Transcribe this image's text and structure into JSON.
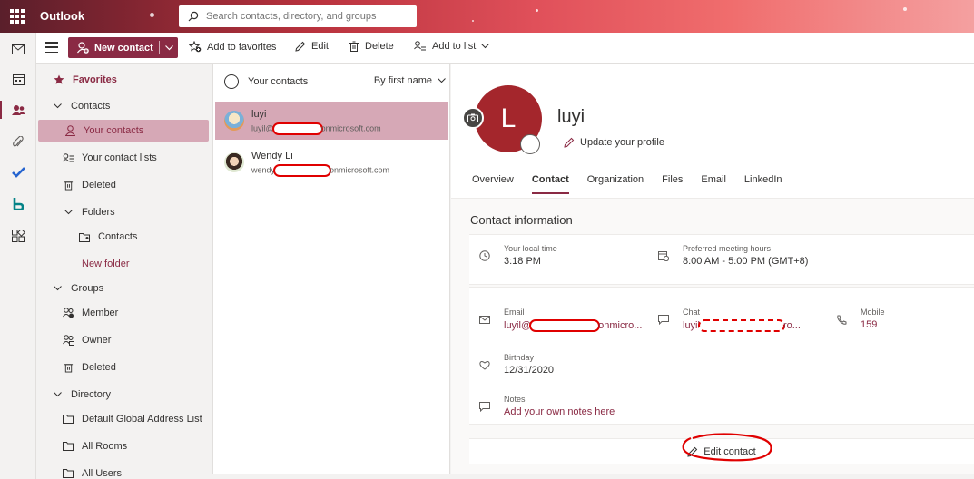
{
  "app": {
    "brand": "Outlook"
  },
  "search": {
    "placeholder": "Search contacts, directory, and groups"
  },
  "toolbar": {
    "new_contact": "New contact",
    "add_to_favorites": "Add to favorites",
    "edit": "Edit",
    "delete": "Delete",
    "add_to_list": "Add to list"
  },
  "nav": {
    "favorites": "Favorites",
    "contacts": "Contacts",
    "your_contacts": "Your contacts",
    "your_contact_lists": "Your contact lists",
    "deleted": "Deleted",
    "folders": "Folders",
    "folder_contacts": "Contacts",
    "new_folder": "New folder",
    "groups": "Groups",
    "member": "Member",
    "owner": "Owner",
    "groups_deleted": "Deleted",
    "directory": "Directory",
    "default_gal": "Default Global Address List",
    "all_rooms": "All Rooms",
    "all_users": "All Users"
  },
  "list": {
    "title": "Your contacts",
    "sort": "By first name",
    "contacts": [
      {
        "name": "luyi",
        "email_prefix": "luyil@",
        "email_suffix": "onmicrosoft.com"
      },
      {
        "name": "Wendy Li",
        "email_prefix": "wendy",
        "email_suffix": "onmicrosoft.com"
      }
    ]
  },
  "profile": {
    "initial": "L",
    "name": "luyi",
    "update_profile": "Update your profile",
    "tabs": [
      "Overview",
      "Contact",
      "Organization",
      "Files",
      "Email",
      "LinkedIn"
    ],
    "active_tab": "Contact",
    "section_title": "Contact information",
    "local_time_label": "Your local time",
    "local_time": "3:18 PM",
    "meeting_hours_label": "Preferred meeting hours",
    "meeting_hours": "8:00 AM - 5:00 PM (GMT+8)",
    "email_label": "Email",
    "email_prefix": "luyil@",
    "email_suffix": "onmicro...",
    "chat_label": "Chat",
    "chat_prefix": "luyil",
    "chat_suffix": "ro...",
    "mobile_label": "Mobile",
    "mobile": "159",
    "birthday_label": "Birthday",
    "birthday": "12/31/2020",
    "notes_label": "Notes",
    "notes_link": "Add your own notes here",
    "edit_contact": "Edit contact"
  },
  "colors": {
    "accent": "#8a2a44",
    "avatar": "#a4262c",
    "selected": "#d6a8b6",
    "annotation": "#e00000"
  }
}
